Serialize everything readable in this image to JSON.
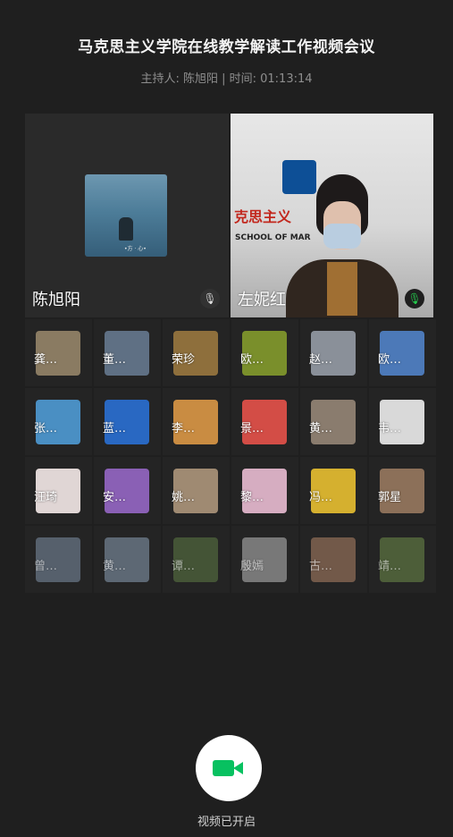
{
  "meeting": {
    "title": "马克思主义学院在线教学解读工作视频会议",
    "meta": "主持人: 陈旭阳 | 时间: 01:13:14"
  },
  "featured": [
    {
      "name": "陈旭阳",
      "mic": "muted",
      "mic_icon": "mic-off-icon"
    },
    {
      "name": "左妮红",
      "mic": "speaking",
      "mic_icon": "mic-on-icon",
      "banner_text": "克思主义",
      "banner_sub": "SCHOOL OF MAR"
    }
  ],
  "participants": [
    {
      "name": "龚…",
      "color": "#8a7b62"
    },
    {
      "name": "董…",
      "color": "#5f7084"
    },
    {
      "name": "荣珍",
      "color": "#8e6f3c"
    },
    {
      "name": "欧…",
      "color": "#7a8f2b"
    },
    {
      "name": "赵…",
      "color": "#8a9099"
    },
    {
      "name": "欧…",
      "color": "#4c79b8"
    },
    {
      "name": "张…",
      "color": "#4a8fc3"
    },
    {
      "name": "蓝…",
      "color": "#2968c2"
    },
    {
      "name": "李…",
      "color": "#c98c42"
    },
    {
      "name": "景…",
      "color": "#d34d46"
    },
    {
      "name": "黄…",
      "color": "#8a7c6e"
    },
    {
      "name": "韦…",
      "color": "#d9d9d9"
    },
    {
      "name": "汪琦",
      "color": "#e0d6d5"
    },
    {
      "name": "安…",
      "color": "#8a60b5"
    },
    {
      "name": "姚…",
      "color": "#9f8a72"
    },
    {
      "name": "黎…",
      "color": "#d6adc1"
    },
    {
      "name": "冯…",
      "color": "#d5b02f"
    },
    {
      "name": "郭星",
      "color": "#8c7059"
    },
    {
      "name": "曾…",
      "color": "#7f92a8"
    },
    {
      "name": "黄…",
      "color": "#8ca0b6"
    },
    {
      "name": "谭…",
      "color": "#5e7b45"
    },
    {
      "name": "殷嫣",
      "color": "#bdbdbd"
    },
    {
      "name": "古…",
      "color": "#b28568"
    },
    {
      "name": "靖…",
      "color": "#6f8e4b"
    }
  ],
  "controls": {
    "camera_label": "视频已开启",
    "accent": "#08c160"
  }
}
